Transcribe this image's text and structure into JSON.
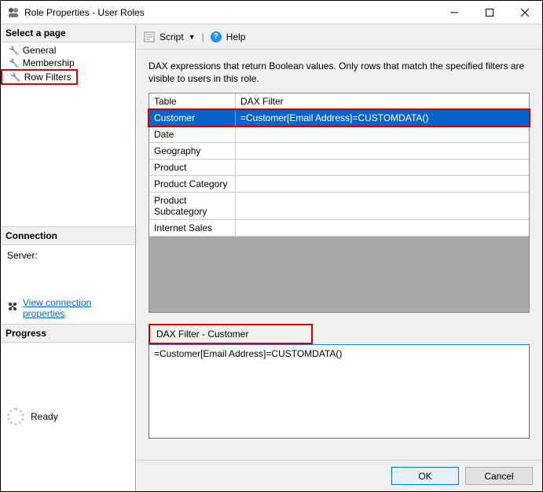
{
  "window": {
    "title": "Role Properties - User Roles"
  },
  "sidebar": {
    "select_page": "Select a page",
    "items": [
      {
        "label": "General"
      },
      {
        "label": "Membership"
      },
      {
        "label": "Row Filters"
      }
    ],
    "connection_header": "Connection",
    "server_label": "Server:",
    "connection_link": "View connection properties",
    "progress_header": "Progress",
    "progress_status": "Ready"
  },
  "toolbar": {
    "script_label": "Script",
    "help_label": "Help"
  },
  "content": {
    "description": "DAX expressions that return Boolean values. Only rows that match the specified filters are visible to users in this role.",
    "columns": {
      "table": "Table",
      "filter": "DAX Filter"
    },
    "rows": [
      {
        "table": "Customer",
        "filter": "=Customer[Email Address]=CUSTOMDATA()"
      },
      {
        "table": "Date",
        "filter": ""
      },
      {
        "table": "Geography",
        "filter": ""
      },
      {
        "table": "Product",
        "filter": ""
      },
      {
        "table": "Product Category",
        "filter": ""
      },
      {
        "table": "Product Subcategory",
        "filter": ""
      },
      {
        "table": "Internet Sales",
        "filter": ""
      }
    ],
    "filter_section_label": "DAX Filter - Customer",
    "filter_value": "=Customer[Email Address]=CUSTOMDATA()"
  },
  "footer": {
    "ok": "OK",
    "cancel": "Cancel"
  }
}
